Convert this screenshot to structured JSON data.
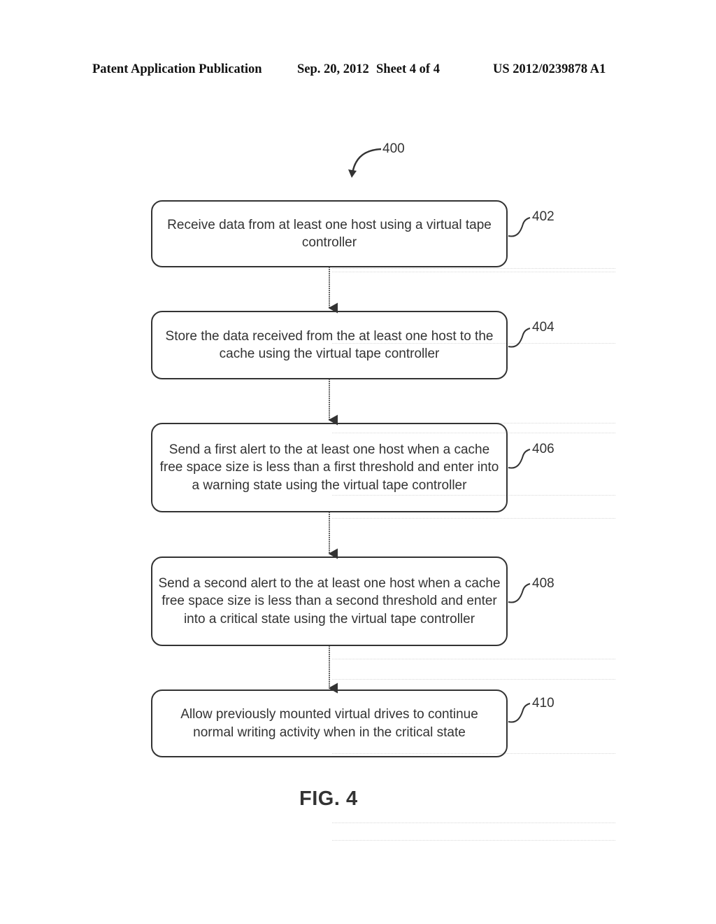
{
  "header": {
    "publication": "Patent Application Publication",
    "date": "Sep. 20, 2012",
    "sheet": "Sheet 4 of 4",
    "patent_number": "US 2012/0239878 A1"
  },
  "figure": {
    "ref": "400",
    "caption": "FIG. 4",
    "steps": [
      {
        "ref": "402",
        "text": "Receive data from at least one host using a virtual tape controller"
      },
      {
        "ref": "404",
        "text": "Store the data received from the at least one host to the cache using the virtual tape controller"
      },
      {
        "ref": "406",
        "text": "Send a first alert to the at least one host when a cache free space size is less than a first threshold and enter into a warning state using the virtual tape controller"
      },
      {
        "ref": "408",
        "text": "Send a second alert to the at least one host when a cache free space size is less than a second threshold and enter into a critical state using the virtual tape controller"
      },
      {
        "ref": "410",
        "text": "Allow previously mounted virtual drives to continue normal writing activity when in the critical state"
      }
    ]
  }
}
